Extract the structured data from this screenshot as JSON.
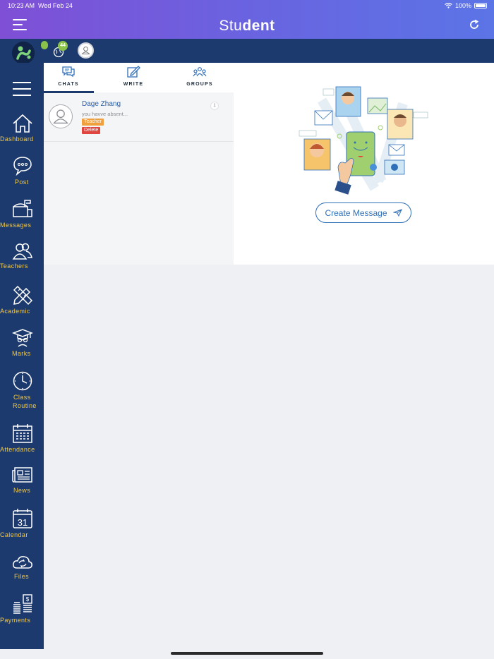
{
  "status": {
    "time": "10:23 AM",
    "date": "Wed Feb 24",
    "battery": "100%"
  },
  "header": {
    "title_light": "Stu",
    "title_bold": "dent"
  },
  "topbar": {
    "notification_count": "44"
  },
  "sidebar": {
    "items": [
      {
        "label": "Dashboard",
        "icon": "home-icon"
      },
      {
        "label": "Post",
        "icon": "chat-bubble-icon"
      },
      {
        "label": "Messages",
        "icon": "mailbox-icon"
      },
      {
        "label": "Teachers",
        "icon": "users-icon"
      },
      {
        "label": "Academic",
        "icon": "pencil-ruler-icon"
      },
      {
        "label": "Marks",
        "icon": "graduate-icon"
      },
      {
        "label": "Class",
        "label2": "Routine",
        "icon": "clock-icon"
      },
      {
        "label": "Attendance",
        "icon": "calendar-grid-icon"
      },
      {
        "label": "News",
        "icon": "newspaper-icon"
      },
      {
        "label": "Calendar",
        "icon": "calendar-31-icon",
        "day": "31"
      },
      {
        "label": "Files",
        "icon": "cloud-sync-icon"
      },
      {
        "label": "Payments",
        "icon": "money-icon"
      }
    ]
  },
  "tabs": [
    {
      "label": "CHATS",
      "active": true
    },
    {
      "label": "WRITE",
      "active": false
    },
    {
      "label": "GROUPS",
      "active": false
    }
  ],
  "chats": [
    {
      "name": "Dage Zhang",
      "preview": "you havve absent...",
      "role": "Teacher",
      "delete_label": "Delete",
      "unread": "1"
    }
  ],
  "empty_state": {
    "button_label": "Create Message"
  },
  "colors": {
    "nav": "#1c3a6e",
    "label": "#f3c844",
    "accent": "#2f6fb8"
  }
}
